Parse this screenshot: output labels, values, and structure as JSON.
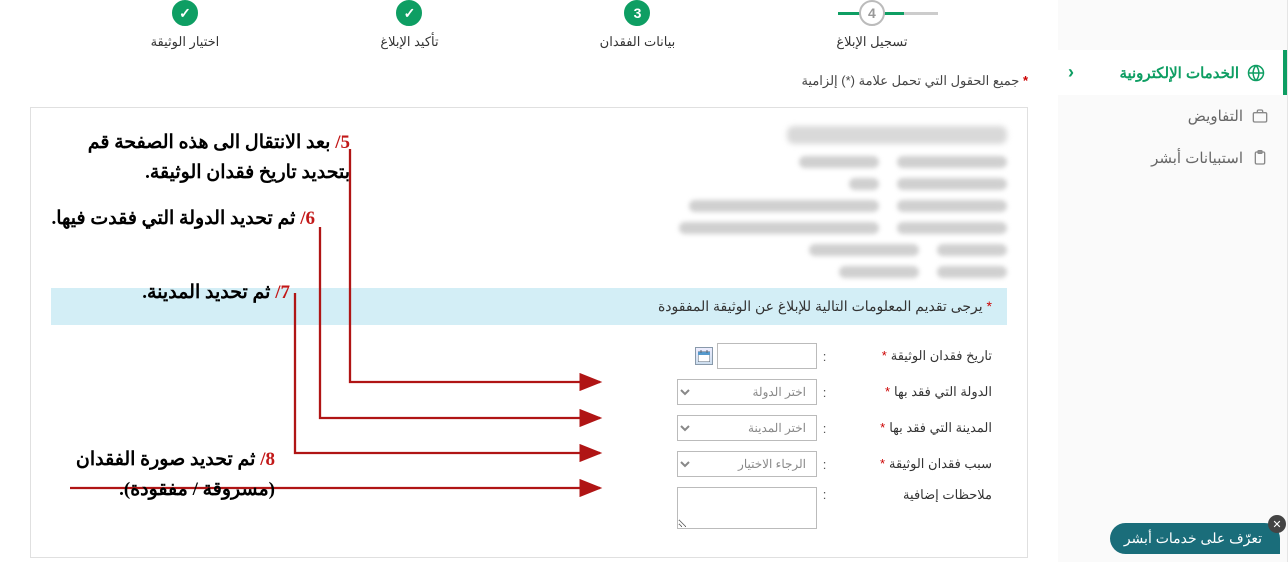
{
  "sidebar": {
    "items": [
      {
        "label": "الخدمات الإلكترونية",
        "icon": "globe"
      },
      {
        "label": "التفاويض",
        "icon": "briefcase"
      },
      {
        "label": "استبيانات أبشر",
        "icon": "clipboard"
      }
    ]
  },
  "stepper": {
    "steps": [
      {
        "label": "اختيار الوثيقة",
        "mark": "✓",
        "state": "done"
      },
      {
        "label": "تأكيد الإبلاغ",
        "mark": "✓",
        "state": "done"
      },
      {
        "label": "بيانات الفقدان",
        "mark": "3",
        "state": "current"
      },
      {
        "label": "تسجيل الإبلاغ",
        "mark": "4",
        "state": "future"
      }
    ]
  },
  "mandatory_note": "جميع الحقول التي تحمل علامة (*) إلزامية",
  "section_header": "يرجى تقديم المعلومات التالية للإبلاغ عن الوثيقة المفقودة",
  "form": {
    "date_label": "تاريخ فقدان الوثيقة",
    "country_label": "الدولة التي فقد بها",
    "country_placeholder": "اختر الدولة",
    "city_label": "المدينة التي فقد بها",
    "city_placeholder": "اختر المدينة",
    "reason_label": "سبب فقدان الوثيقة",
    "reason_placeholder": "الرجاء الاختيار",
    "notes_label": "ملاحظات إضافية"
  },
  "annotations": {
    "a5_num": "5/",
    "a5_text": " بعد الانتقال الى هذه الصفحة قم بتحديد تاريخ فقدان الوثيقة.",
    "a6_num": "6/",
    "a6_text": " ثم تحديد الدولة التي فقدت فيها.",
    "a7_num": "7/",
    "a7_text": " ثم تحديد المدينة.",
    "a8_num": "8/",
    "a8_text": " ثم تحديد صورة الفقدان (مسروقة / مفقودة)."
  },
  "pill_text": "تعرّف على خدمات أبشر"
}
